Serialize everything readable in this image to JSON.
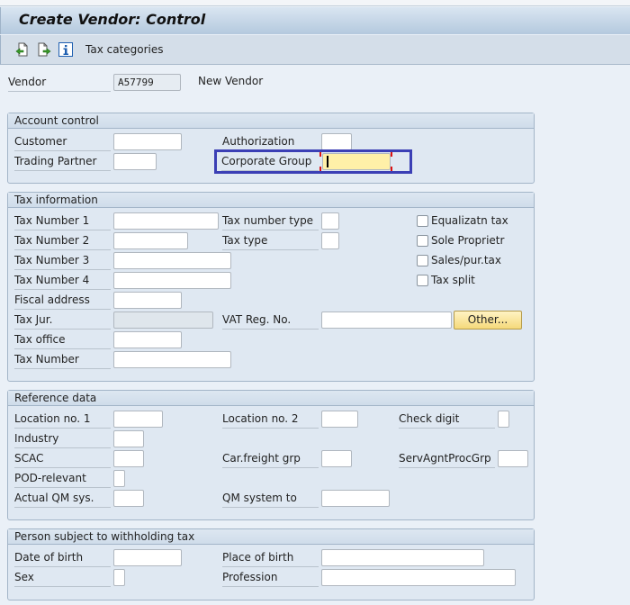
{
  "window": {
    "title": "Create Vendor: Control"
  },
  "toolbar": {
    "items": [
      {
        "icon": "previous-screen-icon",
        "label": ""
      },
      {
        "icon": "next-screen-icon",
        "label": ""
      },
      {
        "icon": "info-icon",
        "label": ""
      }
    ],
    "tax_categories_label": "Tax categories"
  },
  "header": {
    "vendor_label": "Vendor",
    "vendor_value": "A57799",
    "vendor_name": "New Vendor"
  },
  "account_control": {
    "title": "Account control",
    "customer_label": "Customer",
    "customer_value": "",
    "trading_partner_label": "Trading Partner",
    "trading_partner_value": "",
    "authorization_label": "Authorization",
    "authorization_value": "",
    "corporate_group_label": "Corporate Group",
    "corporate_group_value": ""
  },
  "tax_information": {
    "title": "Tax information",
    "tax_number_1_label": "Tax Number 1",
    "tax_number_2_label": "Tax Number 2",
    "tax_number_3_label": "Tax Number 3",
    "tax_number_4_label": "Tax Number 4",
    "fiscal_address_label": "Fiscal address",
    "tax_jur_label": "Tax Jur.",
    "tax_office_label": "Tax office",
    "tax_number_label": "Tax Number",
    "tax_number_type_label": "Tax number type",
    "tax_type_label": "Tax type",
    "vat_reg_no_label": "VAT Reg. No.",
    "other_button": "Other...",
    "checkboxes": [
      {
        "label": "Equalizatn tax",
        "checked": false
      },
      {
        "label": "Sole Proprietr",
        "checked": false
      },
      {
        "label": "Sales/pur.tax",
        "checked": false
      },
      {
        "label": "Tax split",
        "checked": false
      }
    ]
  },
  "reference_data": {
    "title": "Reference data",
    "location_no_1_label": "Location no. 1",
    "industry_label": "Industry",
    "scac_label": "SCAC",
    "pod_relevant_label": "POD-relevant",
    "actual_qm_sys_label": "Actual QM sys.",
    "location_no_2_label": "Location no. 2",
    "car_freight_grp_label": "Car.freight grp",
    "qm_system_to_label": "QM system to",
    "check_digit_label": "Check digit",
    "serv_agnt_proc_grp_label": "ServAgntProcGrp"
  },
  "withholding": {
    "title": "Person subject to withholding tax",
    "date_of_birth_label": "Date of birth",
    "sex_label": "Sex",
    "place_of_birth_label": "Place of birth",
    "profession_label": "Profession"
  },
  "colors": {
    "focus_border": "#3b3fb5",
    "focus_field": "#fff0a8",
    "button_other": "#f5d97a"
  }
}
